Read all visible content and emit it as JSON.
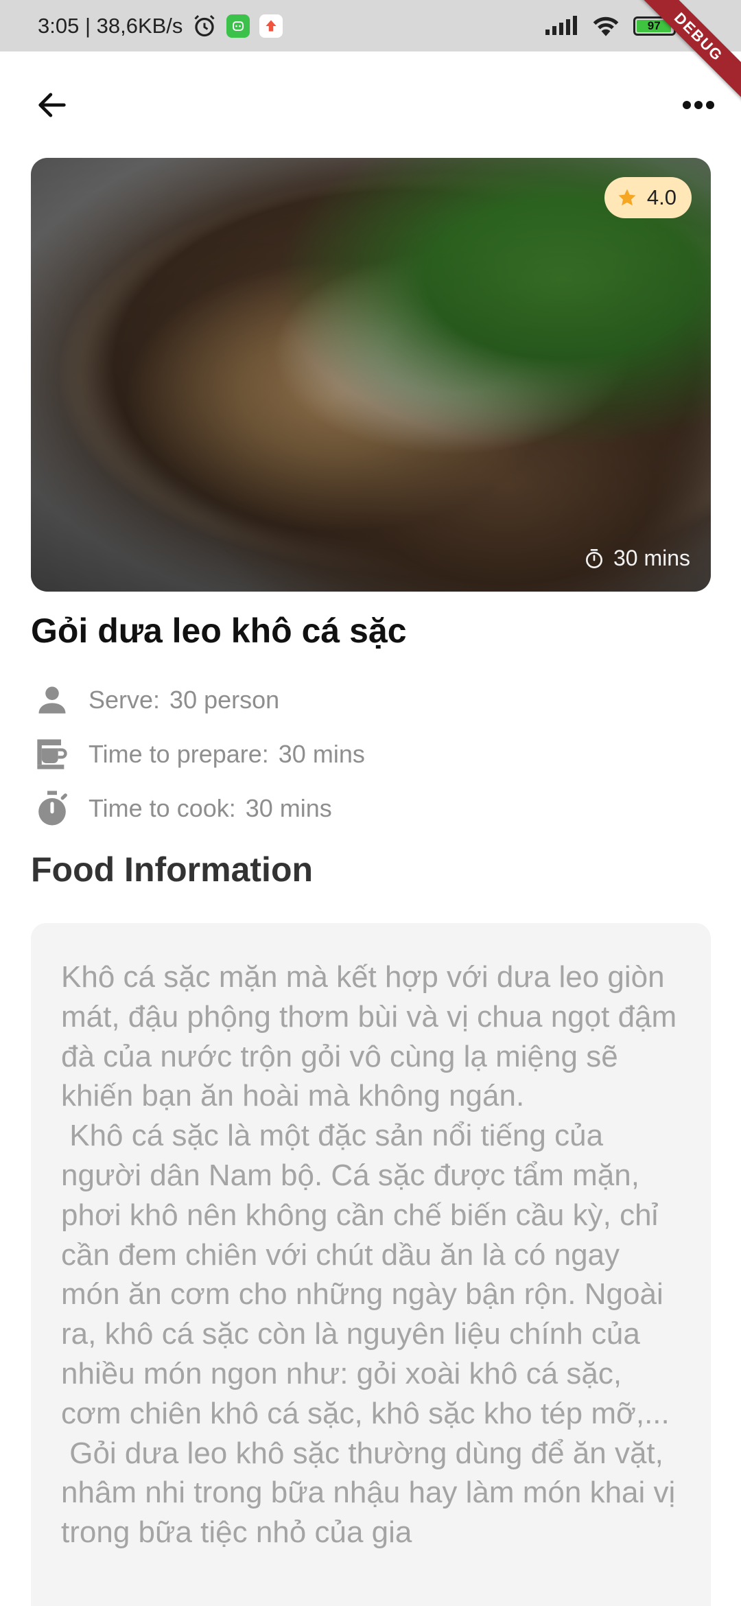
{
  "status_bar": {
    "time_speed": "3:05 | 38,6KB/s",
    "battery": "97",
    "icons": [
      "alarm-icon",
      "app-notification-icon",
      "upload-icon",
      "signal-icon",
      "wifi-icon",
      "battery-icon"
    ]
  },
  "debug_banner": "DEBUG",
  "app_bar": {
    "back_icon": "arrow-back-icon",
    "more_icon": "more-horizontal-icon"
  },
  "hero": {
    "rating": "4.0",
    "time": "30 mins",
    "colors": {
      "rating_chip_bg": "#ffe7b8",
      "star": "#f5a623"
    }
  },
  "dish": {
    "title": "Gỏi dưa leo khô cá sặc",
    "meta": [
      {
        "icon": "person-icon",
        "label": "Serve:",
        "value": "30 person"
      },
      {
        "icon": "coffee-maker-icon",
        "label": "Time to prepare:",
        "value": "30 mins"
      },
      {
        "icon": "timer-icon",
        "label": "Time to cook:",
        "value": "30 mins"
      }
    ]
  },
  "food_information": {
    "heading": "Food Information",
    "text": "Khô cá sặc mặn mà kết hợp với dưa leo giòn mát, đậu phộng thơm bùi và vị chua ngọt đậm đà của nước trộn gỏi vô cùng lạ miệng sẽ khiến bạn ăn hoài mà không ngán.\n Khô cá sặc là một đặc sản nổi tiếng của người dân Nam bộ. Cá sặc được tẩm mặn, phơi khô nên không cần chế biến cầu kỳ, chỉ cần đem chiên với chút dầu ăn là có ngay món ăn cơm cho những ngày bận rộn. Ngoài ra, khô cá sặc còn là nguyên liệu chính của nhiều món ngon như: gỏi xoài khô cá sặc, cơm chiên khô cá sặc, khô sặc kho tép mỡ,...\n Gỏi dưa leo khô sặc thường dùng để ăn vặt, nhâm nhi trong bữa nhậu hay làm món khai vị trong bữa tiệc nhỏ của gia"
  }
}
